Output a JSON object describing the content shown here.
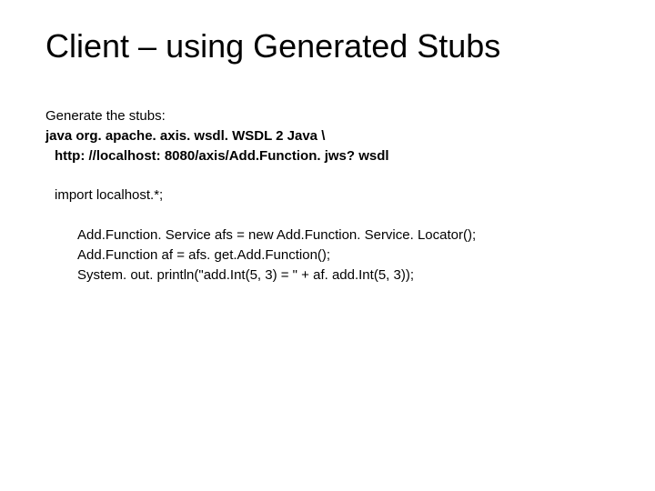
{
  "slide": {
    "title": "Client – using Generated Stubs",
    "line1": "Generate the stubs:",
    "line2": "java org. apache. axis. wsdl. WSDL 2 Java \\",
    "line3": "http: //localhost: 8080/axis/Add.Function. jws? wsdl",
    "line4": "import localhost.*;",
    "line5": "Add.Function. Service afs = new Add.Function. Service. Locator();",
    "line6": "Add.Function af = afs. get.Add.Function();",
    "line7": "System. out. println(\"add.Int(5, 3) = \" + af. add.Int(5, 3));"
  }
}
